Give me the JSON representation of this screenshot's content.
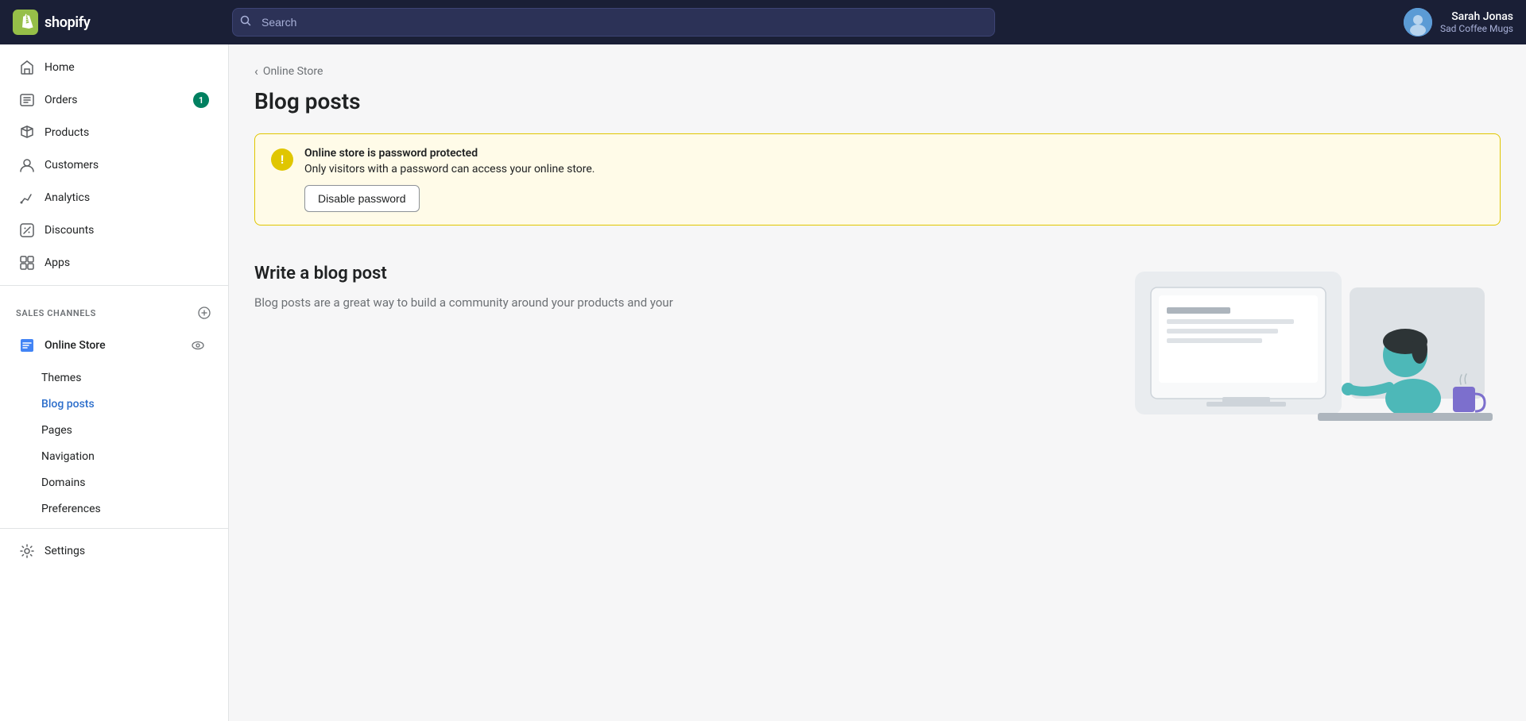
{
  "topNav": {
    "logoText": "shopify",
    "searchPlaceholder": "Search",
    "user": {
      "name": "Sarah Jonas",
      "store": "Sad Coffee Mugs"
    }
  },
  "sidebar": {
    "mainNav": [
      {
        "id": "home",
        "label": "Home",
        "icon": "home-icon",
        "badge": null
      },
      {
        "id": "orders",
        "label": "Orders",
        "icon": "orders-icon",
        "badge": "1"
      },
      {
        "id": "products",
        "label": "Products",
        "icon": "products-icon",
        "badge": null
      },
      {
        "id": "customers",
        "label": "Customers",
        "icon": "customers-icon",
        "badge": null
      },
      {
        "id": "analytics",
        "label": "Analytics",
        "icon": "analytics-icon",
        "badge": null
      },
      {
        "id": "discounts",
        "label": "Discounts",
        "icon": "discounts-icon",
        "badge": null
      },
      {
        "id": "apps",
        "label": "Apps",
        "icon": "apps-icon",
        "badge": null
      }
    ],
    "salesChannels": {
      "label": "SALES CHANNELS",
      "items": [
        {
          "id": "online-store",
          "label": "Online Store",
          "icon": "store-icon"
        }
      ]
    },
    "subNav": [
      {
        "id": "themes",
        "label": "Themes",
        "active": false
      },
      {
        "id": "blog-posts",
        "label": "Blog posts",
        "active": true
      },
      {
        "id": "pages",
        "label": "Pages",
        "active": false
      },
      {
        "id": "navigation",
        "label": "Navigation",
        "active": false
      },
      {
        "id": "domains",
        "label": "Domains",
        "active": false
      },
      {
        "id": "preferences",
        "label": "Preferences",
        "active": false
      }
    ],
    "bottomNav": [
      {
        "id": "settings",
        "label": "Settings",
        "icon": "settings-icon"
      }
    ]
  },
  "breadcrumb": {
    "backLabel": "Online Store"
  },
  "page": {
    "title": "Blog posts"
  },
  "warningBanner": {
    "title": "Online store is password protected",
    "description": "Only visitors with a password can access your online store.",
    "buttonLabel": "Disable password"
  },
  "emptyState": {
    "title": "Write a blog post",
    "description": "Blog posts are a great way to build a community around your products and your"
  }
}
